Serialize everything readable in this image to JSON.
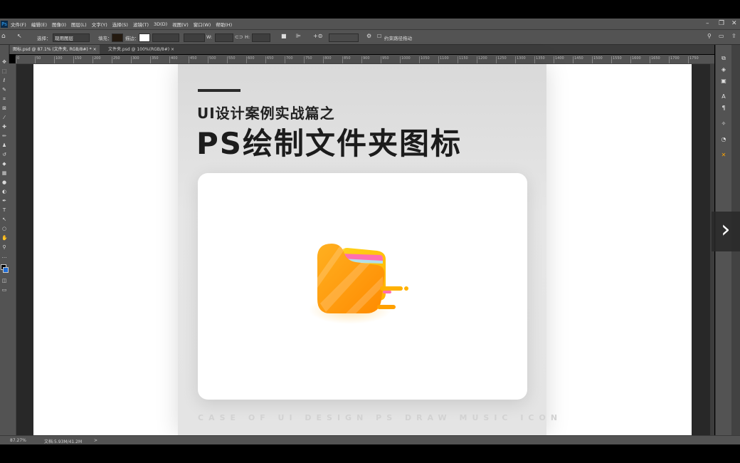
{
  "menu": {
    "items": [
      "文件(F)",
      "编辑(E)",
      "图像(I)",
      "图层(L)",
      "文字(Y)",
      "选择(S)",
      "滤镜(T)",
      "3D(D)",
      "视图(V)",
      "窗口(W)",
      "帮助(H)"
    ]
  },
  "options_bar": {
    "select_label": "选择：",
    "select_value": "现用图层",
    "fill_label": "填充：",
    "stroke_label": "描边：",
    "w_label": "W:",
    "h_label": "H:",
    "checkbox_label": "约束路径拖动"
  },
  "tabs": [
    {
      "label": "图标.psd @ 87.1% (文件夹, RGB/8#) *",
      "close": "×"
    },
    {
      "label": "文件夹.psd @ 100%(RGB/8#)",
      "close": "×"
    }
  ],
  "ruler_ticks": [
    "0",
    "50",
    "100",
    "150",
    "200",
    "250",
    "300",
    "350",
    "400",
    "450",
    "500",
    "550",
    "600",
    "650",
    "700",
    "750",
    "800",
    "850",
    "900",
    "950",
    "1000",
    "1050",
    "1100",
    "1150",
    "1200",
    "1250",
    "1300",
    "1350",
    "1400",
    "1450",
    "1500",
    "1550",
    "1600",
    "1650",
    "1700",
    "1750"
  ],
  "artboard": {
    "subtitle": "UI设计案例实战篇之",
    "title": "PS绘制文件夹图标",
    "footer": "CASE OF UI DESIGN PS DRAW MUSIC ICON"
  },
  "status": {
    "zoom": "87.27%",
    "doc": "文档:5.93M/41.2M",
    "arrow": ">"
  },
  "nav": {
    "next_glyph": "›"
  },
  "colors": {
    "folder_front": "#ff9f0a",
    "folder_back": "#ffc400",
    "folder_paper": "#ff6fb0",
    "accent": "#ffa400"
  }
}
